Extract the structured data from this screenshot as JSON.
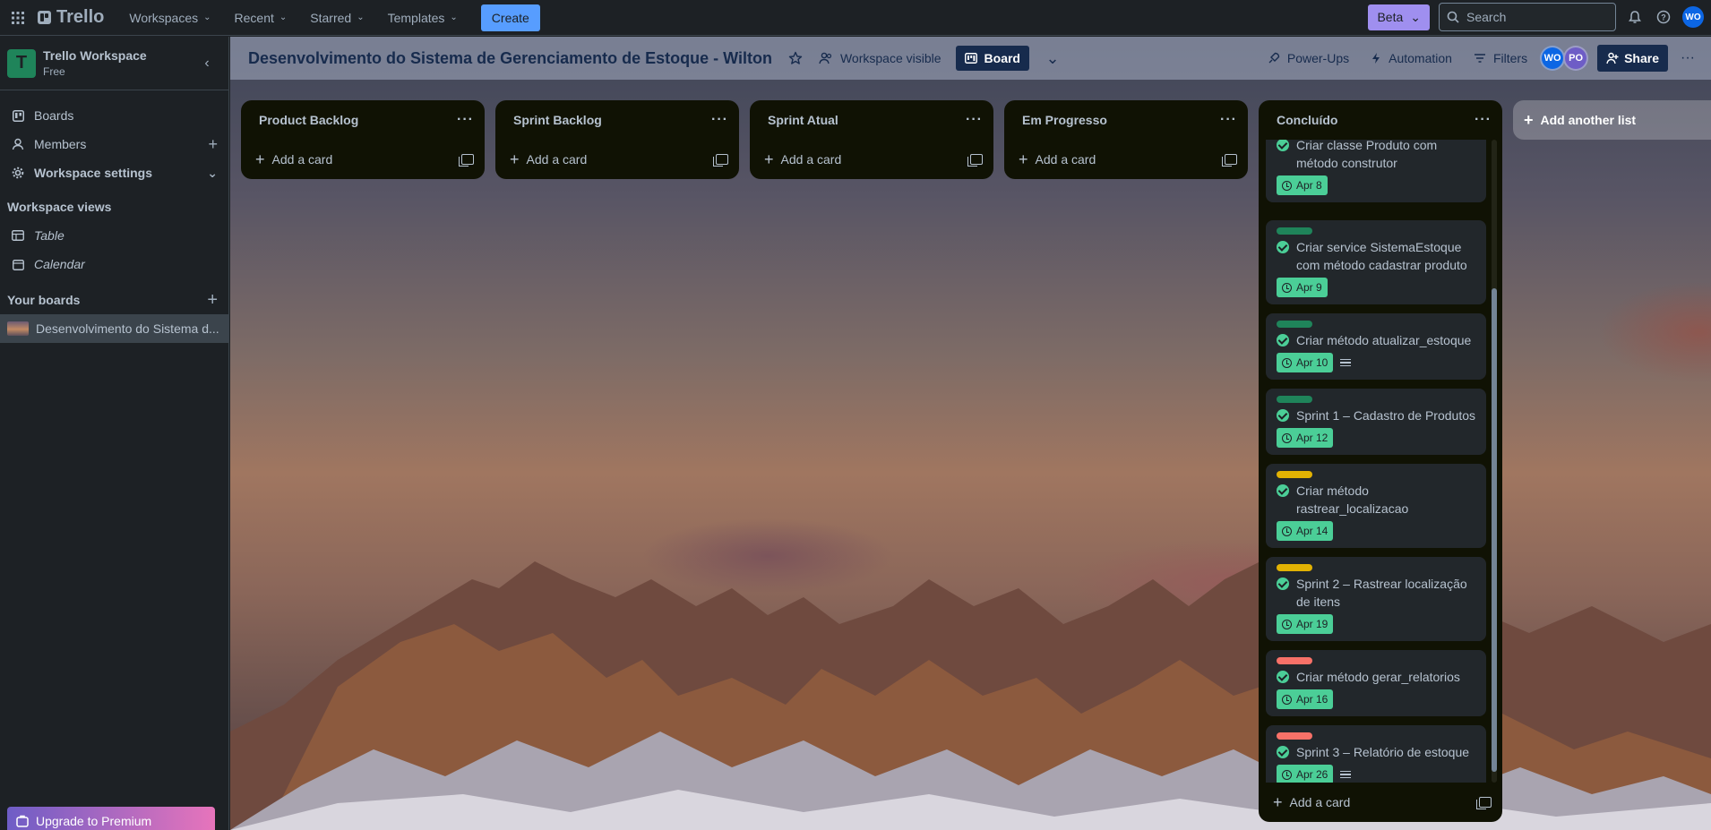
{
  "topbar": {
    "logo": "Trello",
    "menus": [
      "Workspaces",
      "Recent",
      "Starred",
      "Templates"
    ],
    "create": "Create",
    "beta": "Beta",
    "search_placeholder": "Search",
    "user_initials": "WO"
  },
  "sidebar": {
    "workspace_initial": "T",
    "workspace_name": "Trello Workspace",
    "workspace_plan": "Free",
    "items": [
      {
        "label": "Boards",
        "icon": "trello-board-icon"
      },
      {
        "label": "Members",
        "icon": "person-icon"
      },
      {
        "label": "Workspace settings",
        "icon": "gear-icon"
      }
    ],
    "views_heading": "Workspace views",
    "views": [
      {
        "label": "Table",
        "icon": "table-icon"
      },
      {
        "label": "Calendar",
        "icon": "calendar-icon"
      }
    ],
    "your_boards_heading": "Your boards",
    "boards": [
      "Desenvolvimento do Sistema d..."
    ],
    "upgrade": "Upgrade to Premium"
  },
  "board": {
    "title": "Desenvolvimento do Sistema de Gerenciamento de Estoque - Wilton",
    "visibility": "Workspace visible",
    "view": "Board",
    "powerups": "Power-Ups",
    "automation": "Automation",
    "filters": "Filters",
    "members": [
      {
        "initials": "WO",
        "color": "#0c66e4"
      },
      {
        "initials": "PO",
        "color": "#6e5dc6"
      }
    ],
    "share": "Share"
  },
  "lists": [
    {
      "title": "Product Backlog",
      "add": "Add a card"
    },
    {
      "title": "Sprint Backlog",
      "add": "Add a card"
    },
    {
      "title": "Sprint Atual",
      "add": "Add a card"
    },
    {
      "title": "Em Progresso",
      "add": "Add a card"
    }
  ],
  "done_list": {
    "title": "Concluído",
    "add": "Add a card",
    "cards": [
      {
        "title": "Criar classe Produto com método construtor",
        "date": "Apr 8",
        "label_color": "",
        "desc": false
      },
      {
        "title": "Criar service SistemaEstoque com método cadastrar produto",
        "date": "Apr 9",
        "label_color": "#1f845a",
        "desc": false
      },
      {
        "title": "Criar método atualizar_estoque",
        "date": "Apr 10",
        "label_color": "#1f845a",
        "desc": true
      },
      {
        "title": "Sprint 1 – Cadastro de Produtos",
        "date": "Apr 12",
        "label_color": "#1f845a",
        "desc": false
      },
      {
        "title": "Criar método rastrear_localizacao",
        "date": "Apr 14",
        "label_color": "#e2b203",
        "desc": false
      },
      {
        "title": "Sprint 2 – Rastrear localização de itens",
        "date": "Apr 19",
        "label_color": "#e2b203",
        "desc": false
      },
      {
        "title": "Criar método gerar_relatorios",
        "date": "Apr 16",
        "label_color": "#f87168",
        "desc": false
      },
      {
        "title": "Sprint 3 – Relatório de estoque",
        "date": "Apr 26",
        "label_color": "#f87168",
        "desc": true
      }
    ]
  },
  "add_list": "Add another list"
}
